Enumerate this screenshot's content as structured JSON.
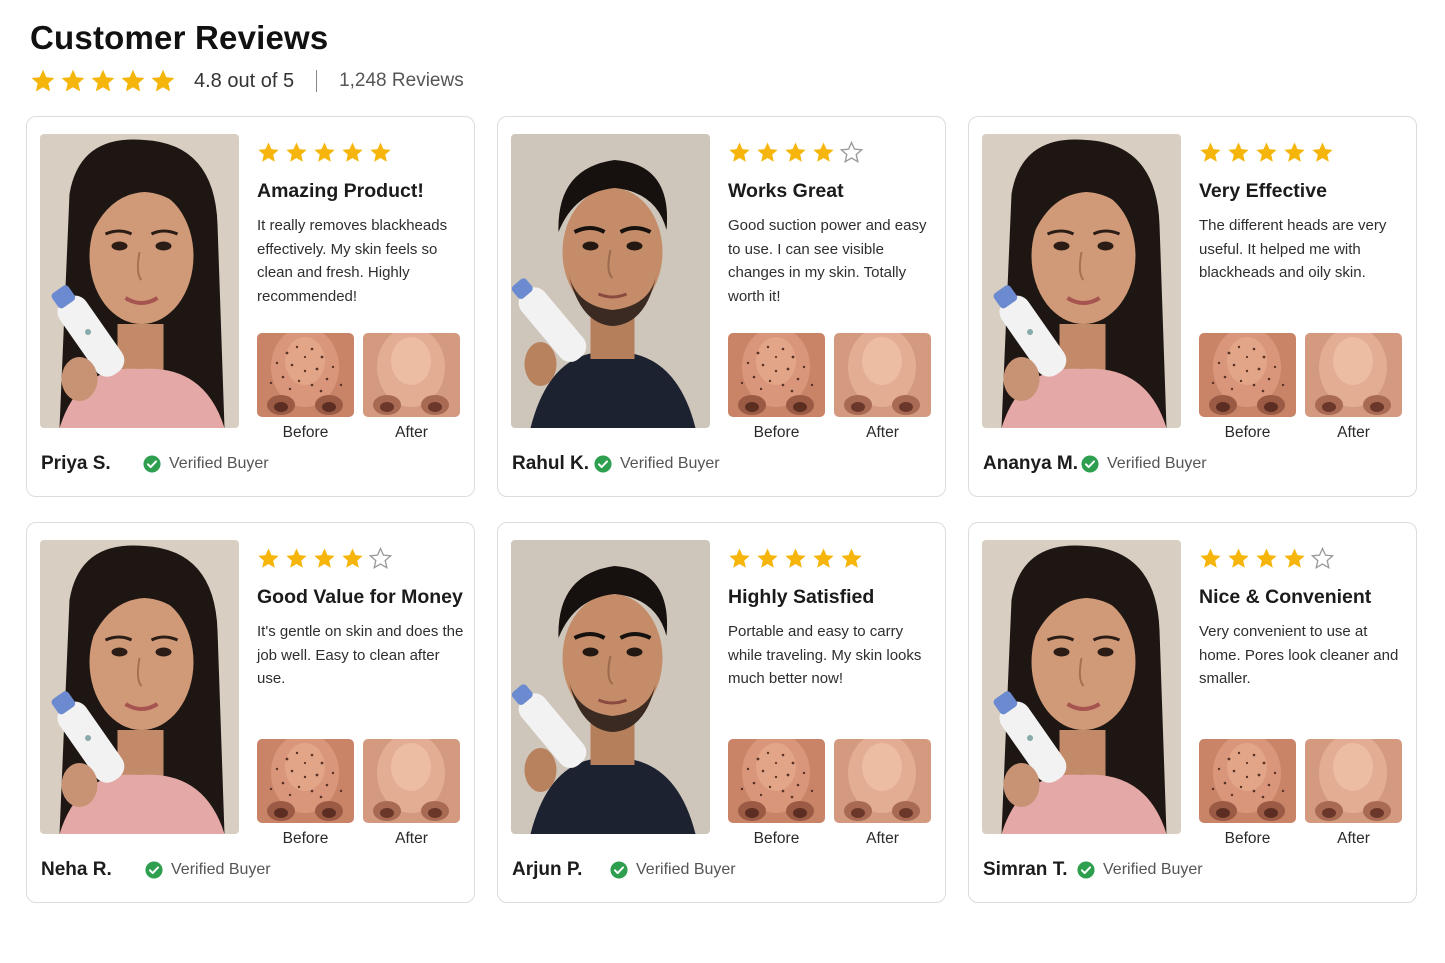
{
  "header": {
    "title": "Customer Reviews",
    "rating_stars": 5,
    "rating_text": "4.8 out of 5",
    "review_count": "1,248 Reviews"
  },
  "colors": {
    "star_filled": "#f5b50a",
    "star_empty": "#9a9a9a",
    "verified_green": "#2e9e4f"
  },
  "labels": {
    "before": "Before",
    "after": "After",
    "verified": "Verified Buyer"
  },
  "reviews": [
    {
      "name": "Priya S.",
      "stars": 5,
      "title": "Amazing Product!",
      "body": "It really removes blackheads effectively. My skin feels so clean and fresh. Highly recommended!",
      "photo": "woman-with-pore-vacuum-photo"
    },
    {
      "name": "Rahul K.",
      "stars": 4,
      "title": "Works Great",
      "body": "Good suction power and easy to use. I can see visible changes in my skin. Totally worth it!",
      "photo": "man-with-pore-vacuum-photo"
    },
    {
      "name": "Ananya M.",
      "stars": 5,
      "title": "Very Effective",
      "body": "The different heads are very useful. It helped me with blackheads and oily skin.",
      "photo": "woman-with-pore-vacuum-photo"
    },
    {
      "name": "Neha R.",
      "stars": 4,
      "title": "Good Value for Money",
      "body": "It's gentle on skin and does the job well. Easy to clean after use.",
      "photo": "woman-with-pore-vacuum-photo"
    },
    {
      "name": "Arjun P.",
      "stars": 5,
      "title": "Highly Satisfied",
      "body": "Portable and easy to carry while traveling. My skin looks much better now!",
      "photo": "man-with-pore-vacuum-photo"
    },
    {
      "name": "Simran T.",
      "stars": 4,
      "title": "Nice & Convenient",
      "body": "Very convenient to use at home. Pores look cleaner and smaller.",
      "photo": "woman-with-pore-vacuum-photo"
    }
  ]
}
